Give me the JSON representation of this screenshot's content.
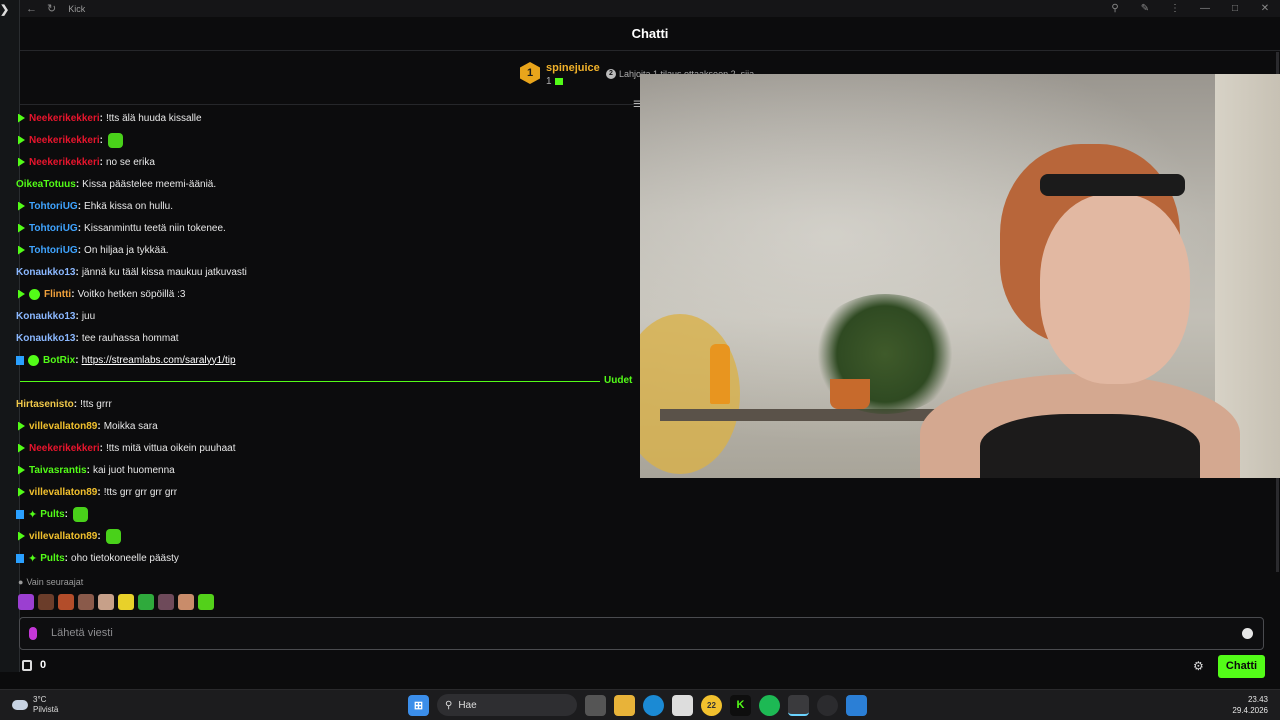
{
  "browser": {
    "tab_title": "Kick"
  },
  "chat": {
    "header_title": "Chatti",
    "pinned": {
      "rank": "1",
      "user": "spinejuice",
      "count": "1",
      "gift_badge": "2",
      "gift_text": "Lahjoita 1 tilaus ottaakseen 2. sija"
    },
    "new_label": "Uudet",
    "messages_before": [
      {
        "user": "Neekerikekkeri",
        "color": "#e8152d",
        "text": "!tts älä huuda kissalle",
        "badges": [
          "sub"
        ]
      },
      {
        "user": "Neekerikekkeri",
        "color": "#e8152d",
        "text": "",
        "badges": [
          "sub"
        ],
        "emote": true
      },
      {
        "user": "Neekerikekkeri",
        "color": "#e8152d",
        "text": "no se erika",
        "badges": [
          "sub"
        ]
      },
      {
        "user": "OikeaTotuus",
        "color": "#53fc18",
        "text": "Kissa päästelee meemi-ääniä.",
        "badges": []
      },
      {
        "user": "TohtoriUG",
        "color": "#3fa4ff",
        "text": "Ehkä kissa on hullu.",
        "badges": [
          "sub"
        ]
      },
      {
        "user": "TohtoriUG",
        "color": "#3fa4ff",
        "text": "Kissanminttu teetä niin tokenee.",
        "badges": [
          "sub"
        ]
      },
      {
        "user": "TohtoriUG",
        "color": "#3fa4ff",
        "text": "On hiljaa ja tykkää.",
        "badges": [
          "sub"
        ]
      },
      {
        "user": "Konaukko13",
        "color": "#8bb8ff",
        "text": "jännä ku tääl kissa maukuu jatkuvasti",
        "badges": []
      },
      {
        "user": "Flintti",
        "color": "#f2a23c",
        "text": "Voitko hetken söpöillä :3",
        "badges": [
          "sub",
          "verified"
        ]
      },
      {
        "user": "Konaukko13",
        "color": "#8bb8ff",
        "text": "juu",
        "badges": []
      },
      {
        "user": "Konaukko13",
        "color": "#8bb8ff",
        "text": "tee rauhassa hommat",
        "badges": []
      },
      {
        "user": "BotRix",
        "color": "#53fc18",
        "text": "https://streamlabs.com/saralyy1/tip",
        "badges": [
          "square",
          "verified"
        ],
        "link": true
      }
    ],
    "messages_after": [
      {
        "user": "Hirtasenisto",
        "color": "#f0c84a",
        "text": "!tts grrr",
        "badges": []
      },
      {
        "user": "villevallaton89",
        "color": "#f2c12e",
        "text": "Moikka sara",
        "badges": [
          "sub"
        ]
      },
      {
        "user": "Neekerikekkeri",
        "color": "#e8152d",
        "text": "!tts mitä vittua oikein puuhaat",
        "badges": [
          "sub"
        ]
      },
      {
        "user": "Taivasrantis",
        "color": "#53fc18",
        "text": "kai juot huomenna",
        "badges": [
          "sub"
        ]
      },
      {
        "user": "villevallaton89",
        "color": "#f2c12e",
        "text": "!tts grr grr grr grr",
        "badges": [
          "sub"
        ]
      },
      {
        "user": "Pults",
        "color": "#53fc18",
        "text": "",
        "badges": [
          "square",
          "spark"
        ],
        "emote": true
      },
      {
        "user": "villevallaton89",
        "color": "#f2c12e",
        "text": "",
        "badges": [
          "sub"
        ],
        "emote": true
      },
      {
        "user": "Pults",
        "color": "#53fc18",
        "text": "oho tietokoneelle päästy",
        "badges": [
          "square",
          "spark"
        ]
      }
    ],
    "followers_only": "Vain seuraajat",
    "emote_colors": [
      "#9b3fd1",
      "#6b3d2a",
      "#b34d2a",
      "#8a5a4a",
      "#c7a089",
      "#e8d12a",
      "#2faa3c",
      "#6e4a5a",
      "#c98c6a",
      "#53d11a"
    ],
    "input_placeholder": "Lähetä viesti",
    "points": "0",
    "send_label": "Chatti"
  },
  "taskbar": {
    "temperature": "3°C",
    "weather": "Pilvistä",
    "search_label": "Hae",
    "notif_badge": "22",
    "time": "23.43",
    "date": "29.4.2026"
  }
}
